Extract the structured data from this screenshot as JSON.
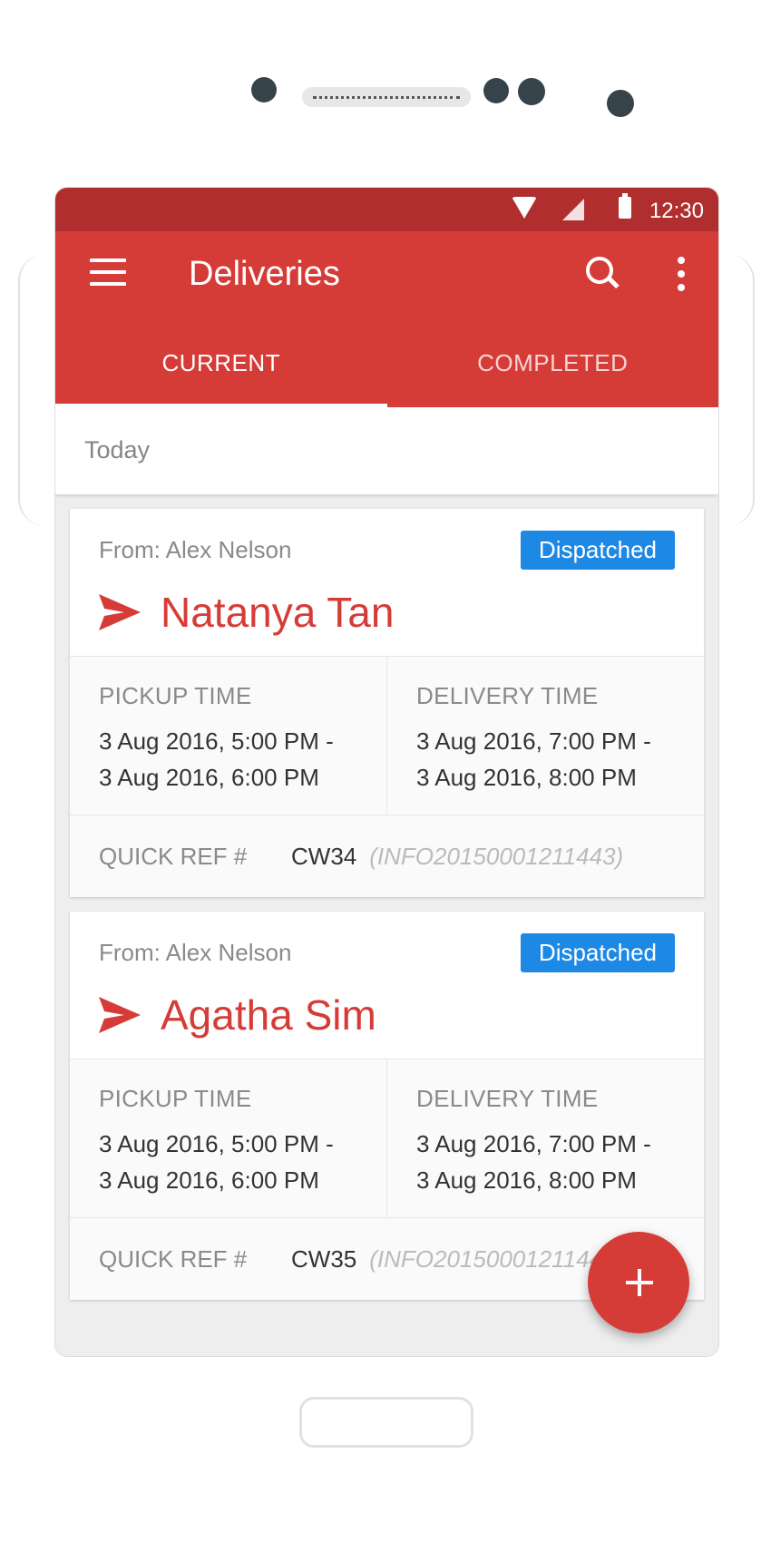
{
  "status_bar": {
    "time": "12:30"
  },
  "app_bar": {
    "title": "Deliveries"
  },
  "tabs": [
    {
      "label": "CURRENT",
      "active": true
    },
    {
      "label": "COMPLETED",
      "active": false
    }
  ],
  "section": {
    "header": "Today"
  },
  "deliveries": [
    {
      "from": "From: Alex Nelson",
      "status": "Dispatched",
      "recipient": "Natanya Tan",
      "pickup_label": "PICKUP TIME",
      "pickup_start": "3 Aug 2016, 5:00 PM -",
      "pickup_end": "3 Aug 2016, 6:00 PM",
      "delivery_label": "DELIVERY TIME",
      "delivery_start": "3 Aug 2016, 7:00 PM -",
      "delivery_end": "3 Aug 2016, 8:00 PM",
      "ref_label": "QUICK REF #",
      "ref_code": "CW34",
      "ref_info": "(INFO20150001211443)"
    },
    {
      "from": "From: Alex Nelson",
      "status": "Dispatched",
      "recipient": "Agatha Sim",
      "pickup_label": "PICKUP TIME",
      "pickup_start": "3 Aug 2016, 5:00 PM -",
      "pickup_end": "3 Aug 2016, 6:00 PM",
      "delivery_label": "DELIVERY TIME",
      "delivery_start": "3 Aug 2016, 7:00 PM -",
      "delivery_end": "3 Aug 2016, 8:00 PM",
      "ref_label": "QUICK REF #",
      "ref_code": "CW35",
      "ref_info": "(INFO2015000121144"
    }
  ],
  "fab": {
    "icon": "plus-icon"
  },
  "colors": {
    "primary": "#d63c37",
    "status_bar": "#b02e2e",
    "badge": "#1e88e5"
  }
}
